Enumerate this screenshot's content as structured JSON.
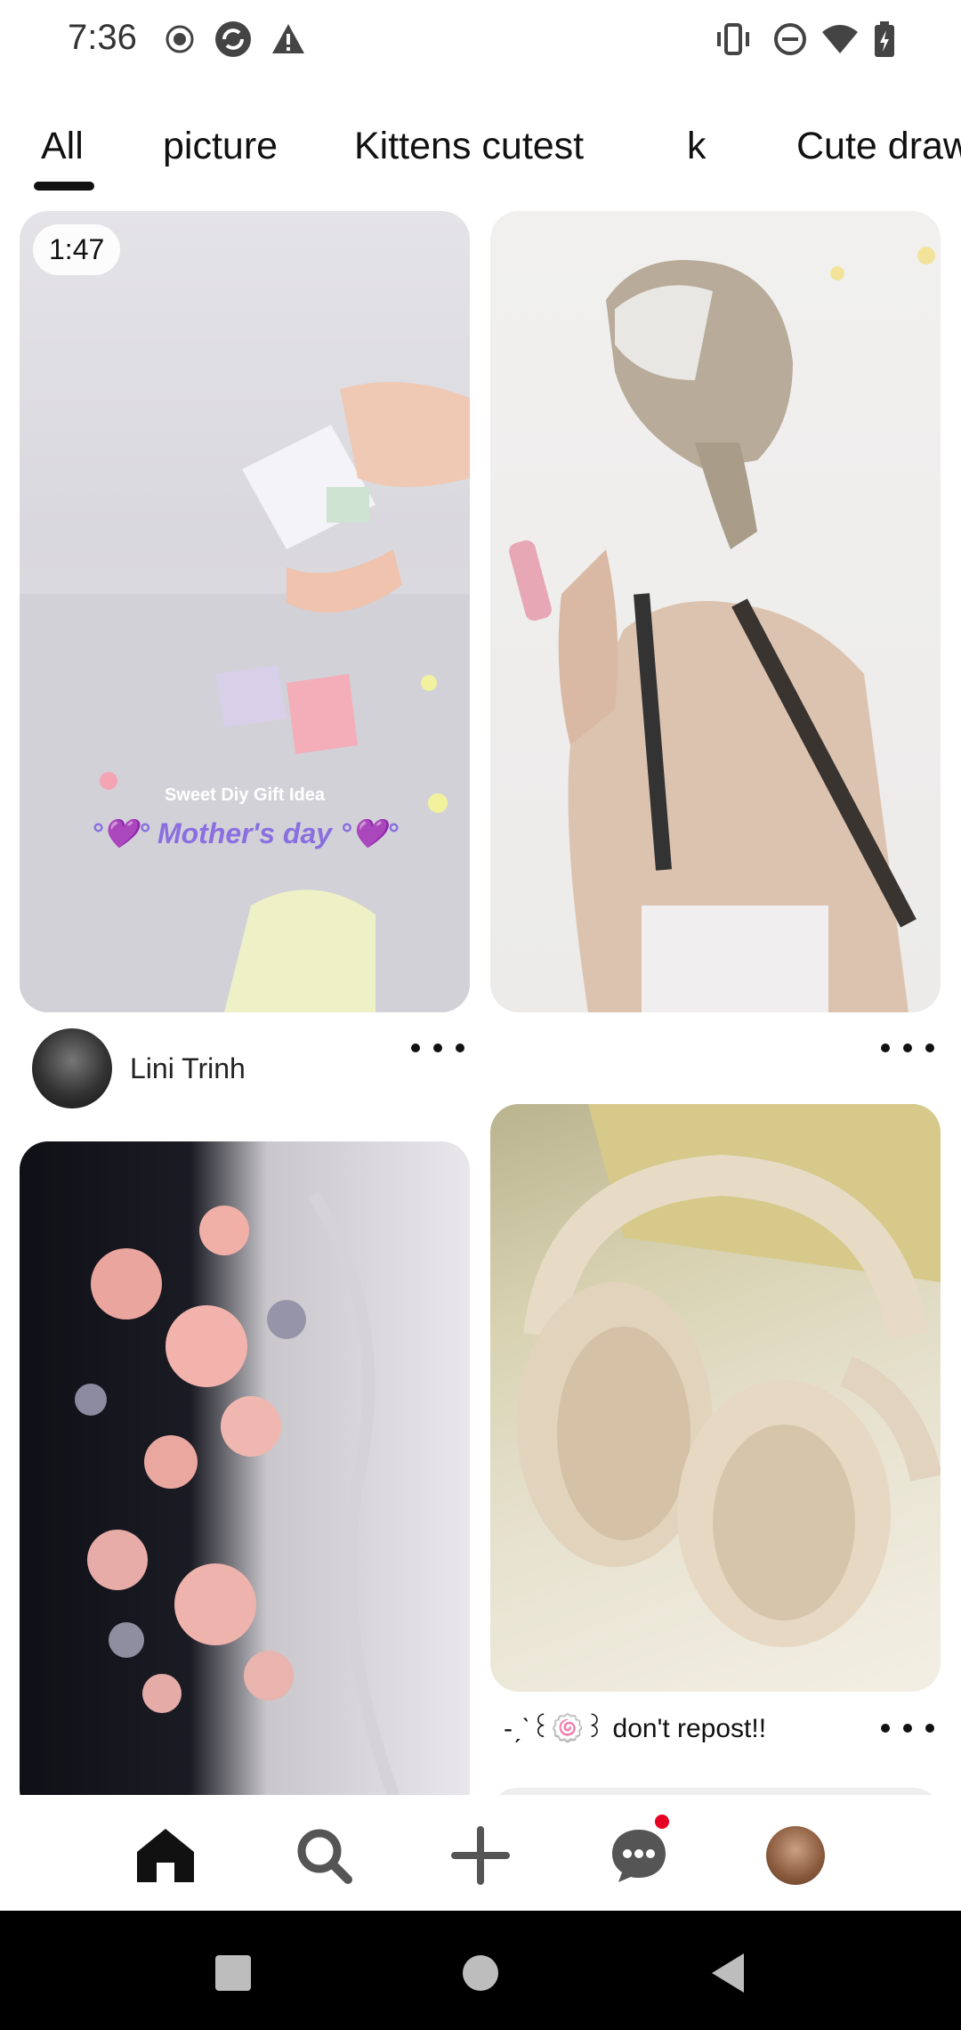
{
  "status_bar": {
    "time": "7:36",
    "left_icons": [
      "record-icon",
      "sync-icon",
      "warning-icon"
    ],
    "right_icons": [
      "vibrate-icon",
      "do-not-disturb-icon",
      "wifi-icon",
      "battery-icon"
    ]
  },
  "tabs": {
    "items": [
      {
        "label": "All",
        "selected": true
      },
      {
        "label": "picture"
      },
      {
        "label": "Kittens cutest"
      },
      {
        "label": "k"
      },
      {
        "label": "Cute drawing"
      }
    ]
  },
  "feed": {
    "pins": [
      {
        "duration": "1:47",
        "overlay_title": "Sweet Diy Gift Idea",
        "overlay_subtitle": "°💜° Mother's day °💜°",
        "author": "Lini Trinh"
      },
      {},
      {},
      {
        "caption": "-ˏˋ꒰🍥꒱ don't repost!!"
      }
    ]
  },
  "bottom_nav": {
    "items": [
      "home-icon",
      "search-icon",
      "create-icon",
      "messages-icon",
      "profile-avatar"
    ],
    "messages_has_notification": true
  },
  "system_nav": [
    "recents-button",
    "home-button",
    "back-button"
  ],
  "colors": {
    "accent": "#e60023",
    "text": "#111111",
    "background": "#ffffff"
  }
}
